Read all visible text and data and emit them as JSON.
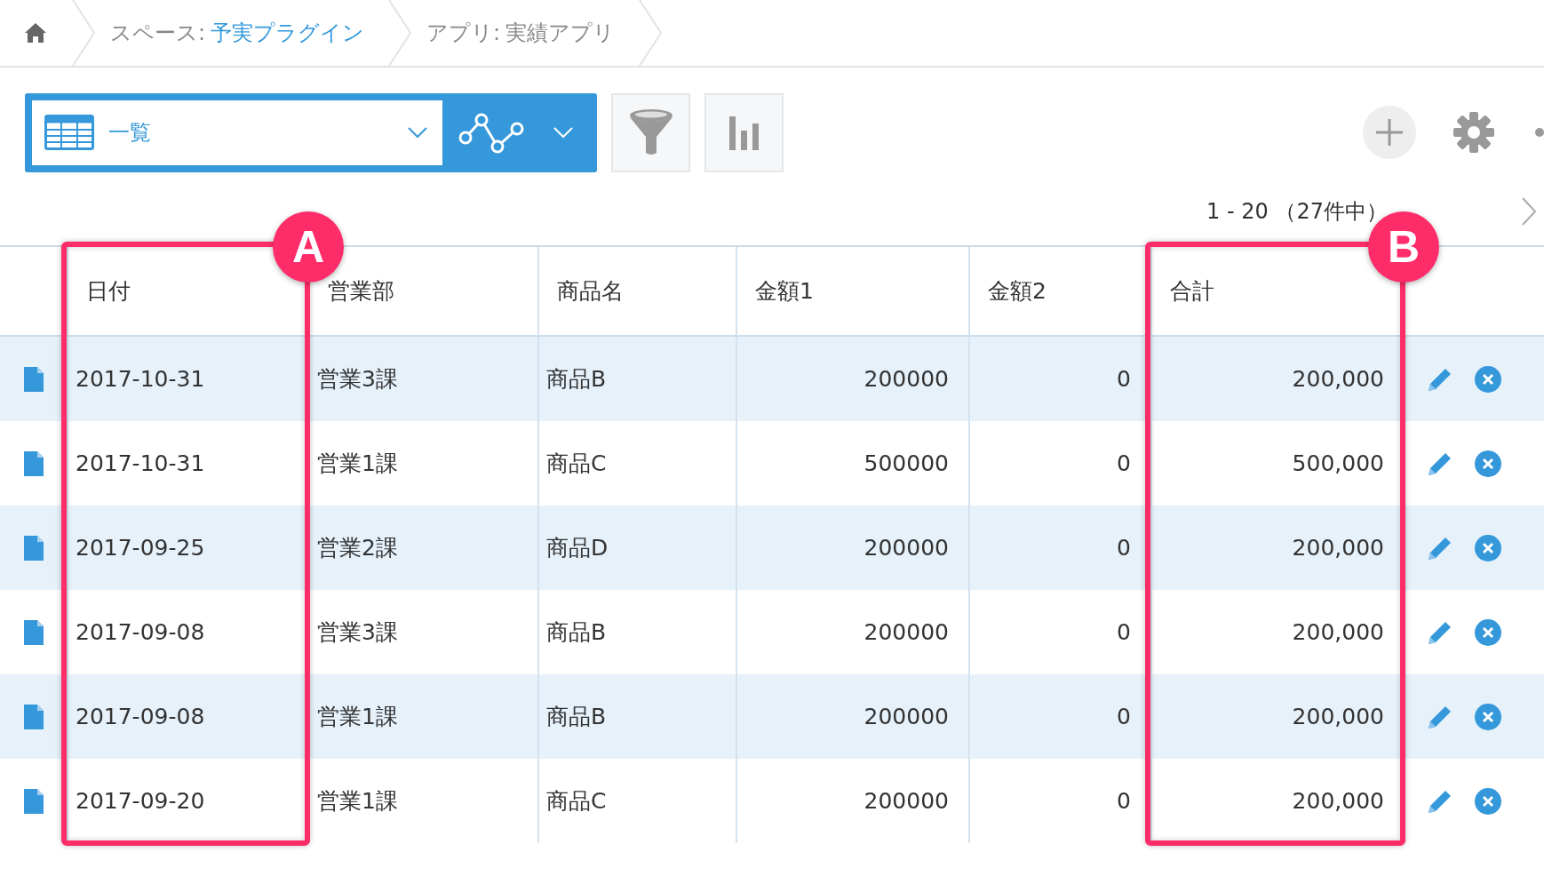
{
  "breadcrumb": [
    {
      "prefix": "スペース:",
      "name": "予実プラグイン",
      "link": true
    },
    {
      "prefix": "アプリ:",
      "name": "実績アプリ",
      "link": false
    }
  ],
  "view": {
    "label": "一覧"
  },
  "pagination": {
    "text": "1 - 20 （27件中）"
  },
  "table": {
    "columns": [
      {
        "label": "日付",
        "kind": "text",
        "annotation": "A"
      },
      {
        "label": "営業部",
        "kind": "text"
      },
      {
        "label": "商品名",
        "kind": "text"
      },
      {
        "label": "金額1",
        "kind": "number"
      },
      {
        "label": "金額2",
        "kind": "number"
      },
      {
        "label": "合計",
        "kind": "number",
        "annotation": "B"
      }
    ],
    "rows": [
      [
        "2017-10-31",
        "営業3課",
        "商品B",
        "200000",
        "0",
        "200,000"
      ],
      [
        "2017-10-31",
        "営業1課",
        "商品C",
        "500000",
        "0",
        "500,000"
      ],
      [
        "2017-09-25",
        "営業2課",
        "商品D",
        "200000",
        "0",
        "200,000"
      ],
      [
        "2017-09-08",
        "営業3課",
        "商品B",
        "200000",
        "0",
        "200,000"
      ],
      [
        "2017-09-08",
        "営業1課",
        "商品B",
        "200000",
        "0",
        "200,000"
      ],
      [
        "2017-09-20",
        "営業1課",
        "商品C",
        "200000",
        "0",
        "200,000"
      ]
    ]
  }
}
